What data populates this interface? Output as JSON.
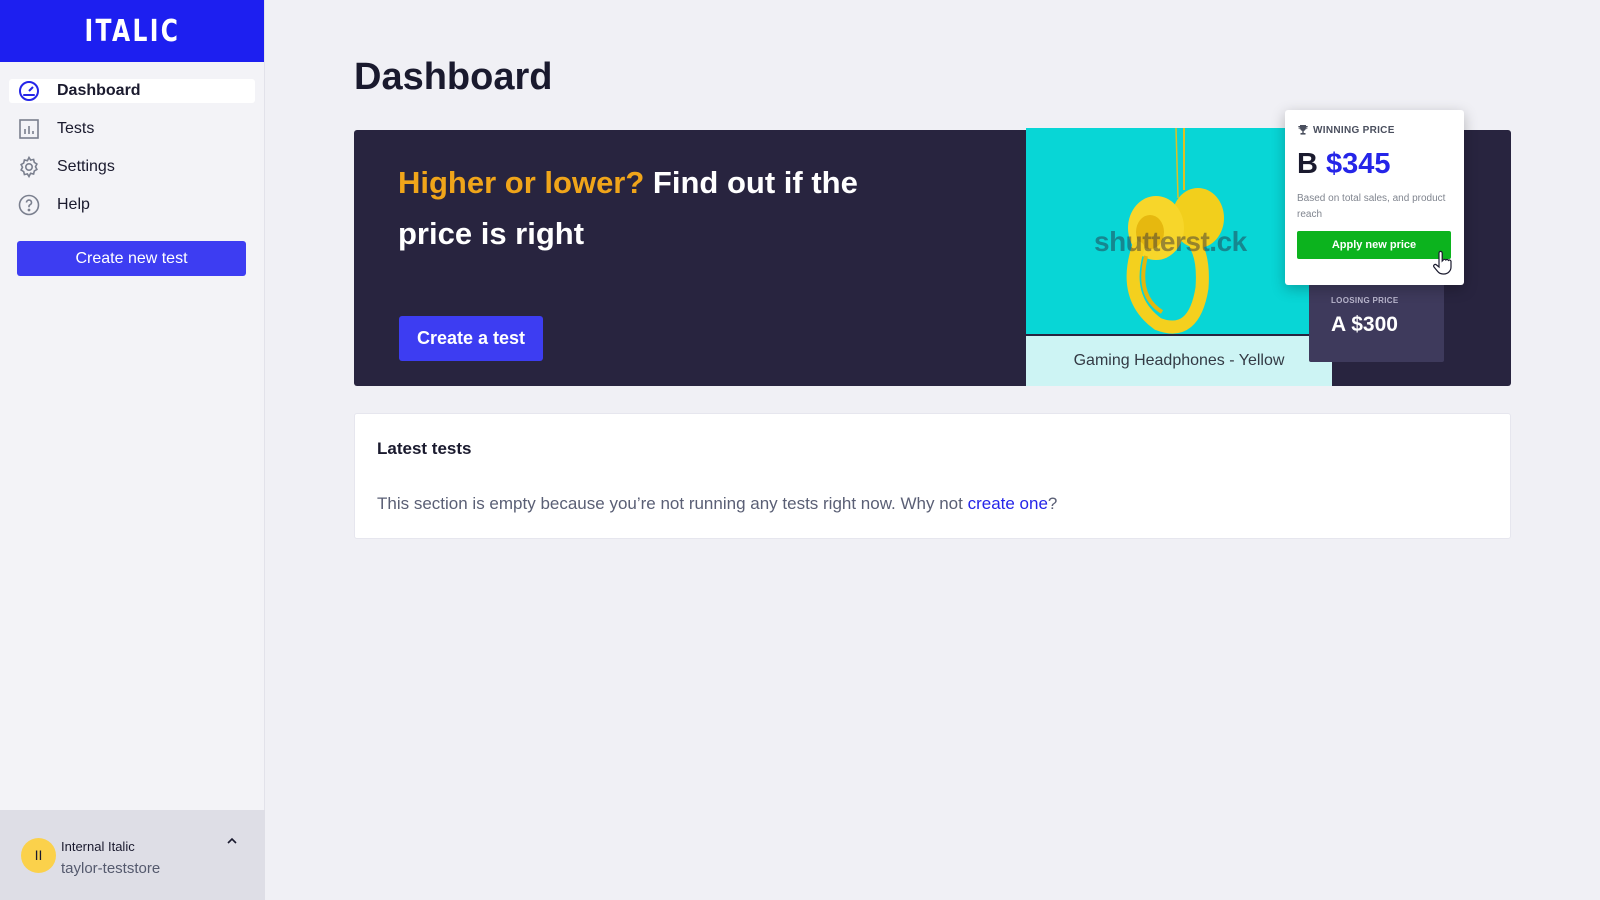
{
  "brand": {
    "logo_text": "ITALIC",
    "color": "#1d1ff0"
  },
  "sidebar": {
    "items": [
      {
        "label": "Dashboard",
        "icon": "gauge-icon",
        "active": true
      },
      {
        "label": "Tests",
        "icon": "bar-chart-icon",
        "active": false
      },
      {
        "label": "Settings",
        "icon": "gear-icon",
        "active": false
      },
      {
        "label": "Help",
        "icon": "help-circle-icon",
        "active": false
      }
    ],
    "create_button": "Create new test"
  },
  "account": {
    "avatar_initials": "II",
    "org_name": "Internal Italic",
    "store_name": "taylor-teststore",
    "toggle_icon": "chevron-up-icon"
  },
  "page": {
    "title": "Dashboard"
  },
  "hero": {
    "heading_accent": "Higher or lower?",
    "heading_rest": " Find out if the price is right",
    "cta": "Create a test",
    "accent_color": "#f0a51a",
    "product": {
      "watermark": "shutterst.ck",
      "caption": "Gaming Headphones - Yellow"
    },
    "winning": {
      "label": "WINNING PRICE",
      "variant": "B",
      "price": "$345",
      "note": "Based on total sales, and product reach",
      "button": "Apply new price"
    },
    "losing": {
      "label": "LOOSING PRICE",
      "value": "A $300"
    }
  },
  "latest_tests": {
    "title": "Latest tests",
    "empty_message": "This section is empty because you’re not running any tests right now. Why not ",
    "link_text": "create one",
    "suffix": "?"
  }
}
